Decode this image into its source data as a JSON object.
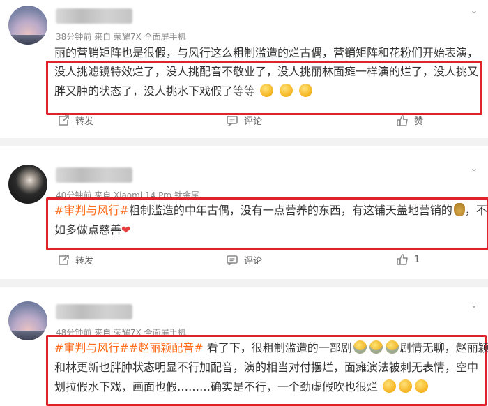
{
  "posts": [
    {
      "meta": "38分钟前   来自 荣耀7X 全面屏手机",
      "line1": "丽的营销矩阵也是很假，与风行这么粗制滥造的烂古偶，营销矩阵和花粉们开始表演，",
      "line2": "没人挑滤镜特效烂了，没人挑配音不敬业了，没人挑丽林面瘫一样演的烂了，没人挑又",
      "line3": "胖又肿的状态了，没人挑水下戏假了等等",
      "actions": {
        "repost": "转发",
        "comment": "评论",
        "like": "赞"
      }
    },
    {
      "meta": "40分钟前   来自 Xiaomi 14 Pro 钛金属",
      "line1_tag": "#审判与风行#",
      "line1_text": "粗制滥造的中年古偶，没有一点营养的东西，有这铺天盖地营销的",
      "line1_end": "，不",
      "line2": "如多做点慈善",
      "actions": {
        "repost": "转发",
        "comment": "评论",
        "like": "1"
      }
    },
    {
      "meta": "48分钟前   来自 荣耀7X 全面屏手机",
      "line1_tag1": "#审判与风行#",
      "line1_tag2": "#赵丽颖配音#",
      "line1_text": " 看了下，很粗制滥造的一部剧",
      "line1_end": "剧情无聊，赵丽颖",
      "line2": "和林更新也胖肿状态明显不行加配音，演的相当对付摆烂，面瘫演法被刺无表情，空中",
      "line3": "划拉假水下戏，画面也假………确实是不行，一个劲虚假吹也很烂"
    }
  ],
  "icons": [
    "avatar",
    "chevron-down-icon",
    "repost-icon",
    "comment-icon",
    "like-icon",
    "emoji-icon",
    "moneybag-icon",
    "heart-icon"
  ],
  "colors": {
    "highlight_border": "#e0222a",
    "hashtag": "#ff6a18",
    "separator": "#f2f2f2"
  }
}
